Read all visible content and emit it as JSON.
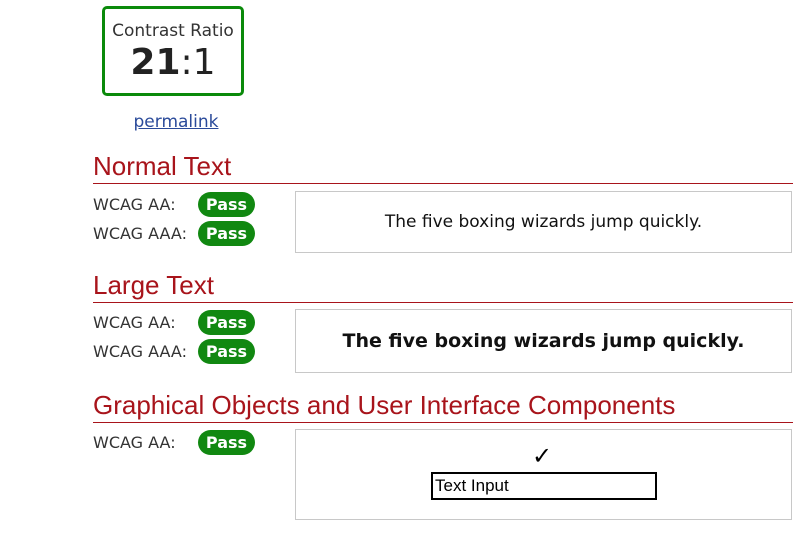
{
  "contrast": {
    "label": "Contrast Ratio",
    "ratio_lhs": "21",
    "ratio_sep": ":",
    "ratio_rhs": "1",
    "border_color": "#0a8a0a"
  },
  "permalink": "permalink",
  "sections": {
    "normal": {
      "title": "Normal Text",
      "rows": [
        {
          "label": "WCAG AA:",
          "result": "Pass"
        },
        {
          "label": "WCAG AAA:",
          "result": "Pass"
        }
      ],
      "sample": "The five boxing wizards jump quickly."
    },
    "large": {
      "title": "Large Text",
      "rows": [
        {
          "label": "WCAG AA:",
          "result": "Pass"
        },
        {
          "label": "WCAG AAA:",
          "result": "Pass"
        }
      ],
      "sample": "The five boxing wizards jump quickly."
    },
    "graphics": {
      "title": "Graphical Objects and User Interface Components",
      "rows": [
        {
          "label": "WCAG AA:",
          "result": "Pass"
        }
      ],
      "checkmark": "✓",
      "input_value": "Text Input"
    }
  },
  "colors": {
    "heading": "#a8141b",
    "pass_badge": "#118811",
    "link": "#2a4a9a"
  }
}
